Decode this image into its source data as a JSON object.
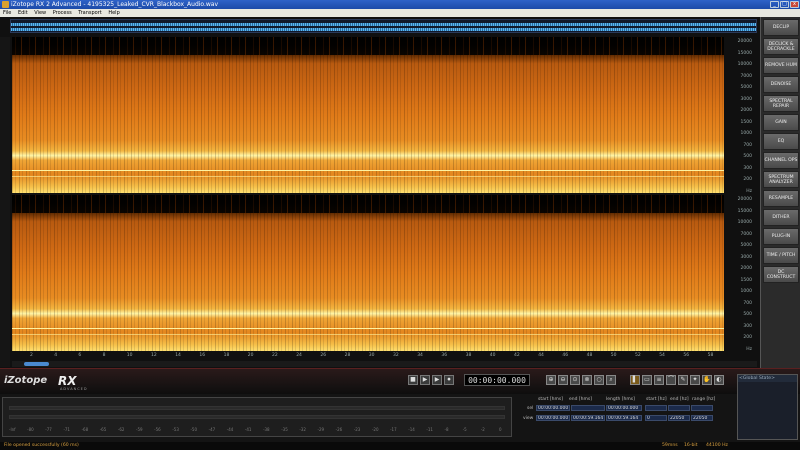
{
  "window": {
    "title": "iZotope RX 2 Advanced - 4195325_Leaked_CVR_Blackbox_Audio.wav"
  },
  "menu": [
    "File",
    "Edit",
    "View",
    "Process",
    "Transport",
    "Help"
  ],
  "modules": [
    "DECLIP",
    "DECLICK & DECRACKLE",
    "REMOVE HUM",
    "DENOISE",
    "SPECTRAL REPAIR",
    "GAIN",
    "EQ",
    "CHANNEL OPS",
    "SPECTRUM ANALYZER",
    "RESAMPLE",
    "DITHER",
    "PLUG-IN",
    "TIME / PITCH",
    "DC CONSTRUCT"
  ],
  "freq_scale": [
    "20000",
    "15000",
    "10000",
    "7000",
    "5000",
    "3000",
    "2000",
    "1500",
    "1000",
    "700",
    "500",
    "300",
    "200",
    "Hz"
  ],
  "time_ticks": [
    "2",
    "4",
    "6",
    "8",
    "10",
    "12",
    "14",
    "16",
    "18",
    "20",
    "22",
    "24",
    "26",
    "28",
    "30",
    "32",
    "34",
    "36",
    "38",
    "40",
    "42",
    "44",
    "46",
    "48",
    "50",
    "52",
    "54",
    "56",
    "58"
  ],
  "transport": {
    "timecode": "00:00:00.000",
    "buttons": [
      "■",
      "▶",
      "▶",
      "⏺"
    ]
  },
  "logo": {
    "brand": "iZotope",
    "product": "RX",
    "sub": "ADVANCED"
  },
  "meter_ticks": [
    "-Inf",
    "-80",
    "-77",
    "-71",
    "-68",
    "-65",
    "-62",
    "-59",
    "-56",
    "-53",
    "-50",
    "-47",
    "-44",
    "-41",
    "-38",
    "-35",
    "-32",
    "-29",
    "-26",
    "-23",
    "-20",
    "-17",
    "-14",
    "-11",
    "-8",
    "-5",
    "-2",
    "0"
  ],
  "selection": {
    "headers": {
      "start": "start [hms]",
      "end": "end [hms]",
      "length": "length [hms]",
      "fstart": "start [hz]",
      "fend": "end [hz]",
      "range": "range [hz]"
    },
    "sel_label": "sel",
    "view_label": "view",
    "sel": {
      "start": "00:00:00.000",
      "end": "",
      "length": "00:00:00.000",
      "fstart": "",
      "fend": "",
      "range": ""
    },
    "view": {
      "start": "00:00:00.000",
      "end": "00:00:59.164",
      "length": "00:00:59.164",
      "fstart": "0",
      "fend": "22050",
      "range": "22050"
    }
  },
  "info_panel": {
    "header": "<Global State>"
  },
  "status": {
    "message": "File opened successfully (60 ms)",
    "length": "59mns",
    "bits": "16-bit",
    "rate": "44100 Hz"
  }
}
